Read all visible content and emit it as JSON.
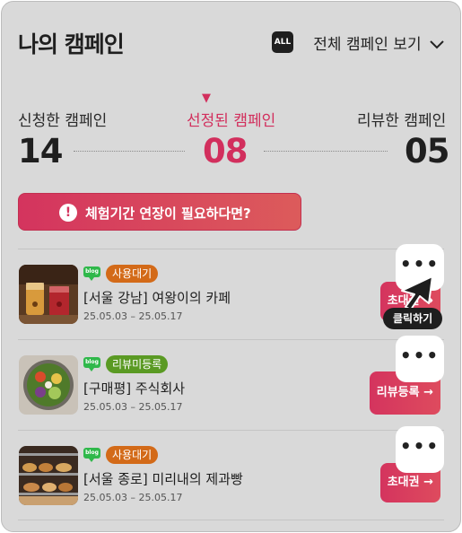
{
  "header": {
    "title": "나의 캠페인",
    "filter_badge": "ALL",
    "view_all_label": "전체 캠페인 보기"
  },
  "stats": {
    "applied": {
      "label": "신청한 캠페인",
      "value": "14"
    },
    "selected": {
      "label": "선정된 캠페인",
      "value": "08"
    },
    "review": {
      "label": "리뷰한 캠페인",
      "value": "05"
    }
  },
  "notice": {
    "label": "체험기간 연장이 필요하다면?"
  },
  "campaigns": [
    {
      "platform": "blog",
      "status": "사용대기",
      "name": "[서울 강남] 여왕이의 카페",
      "date": "25.05.03 – 25.05.17",
      "action": "초대권 →"
    },
    {
      "platform": "blog",
      "status": "리뷰미등록",
      "name": "[구매평] 주식회사",
      "date": "25.05.03 – 25.05.17",
      "action": "리뷰등록 →"
    },
    {
      "platform": "blog",
      "status": "사용대기",
      "name": "[서울 종로] 미리내의 제과빵",
      "date": "25.05.03 – 25.05.17",
      "action": "초대권 →"
    }
  ],
  "more_label": "•••",
  "tooltip": "클릭하기",
  "colors": {
    "accent": "#d22f5d",
    "waiting_badge": "#d36a18",
    "review_badge": "#5a9a23",
    "blog_icon": "#2fb84a"
  },
  "icons": [
    "alert-icon",
    "chevron-down-icon",
    "blog-icon",
    "more-icon",
    "cursor-icon"
  ]
}
